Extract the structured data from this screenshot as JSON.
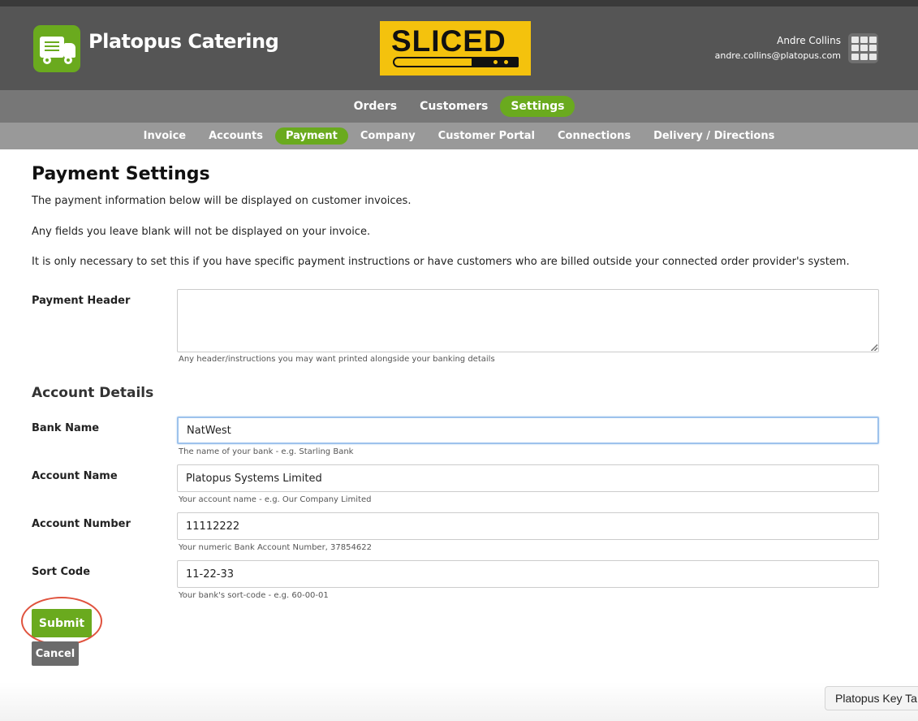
{
  "header": {
    "brand": "Platopus Catering",
    "partner_logo_text": "SLICED",
    "user_name": "Andre Collins",
    "user_email": "andre.collins@platopus.com"
  },
  "nav_primary": [
    {
      "label": "Orders",
      "active": false
    },
    {
      "label": "Customers",
      "active": false
    },
    {
      "label": "Settings",
      "active": true
    }
  ],
  "nav_secondary": [
    {
      "label": "Invoice",
      "active": false
    },
    {
      "label": "Accounts",
      "active": false
    },
    {
      "label": "Payment",
      "active": true
    },
    {
      "label": "Company",
      "active": false
    },
    {
      "label": "Customer Portal",
      "active": false
    },
    {
      "label": "Connections",
      "active": false
    },
    {
      "label": "Delivery / Directions",
      "active": false
    }
  ],
  "page": {
    "title": "Payment Settings",
    "intro": [
      "The payment information below will be displayed on customer invoices.",
      "Any fields you leave blank will not be displayed on your invoice.",
      "It is only necessary to set this if you have specific payment instructions or have customers who are billed outside your connected order provider's system."
    ]
  },
  "form": {
    "payment_header": {
      "label": "Payment Header",
      "value": "",
      "help": "Any header/instructions you may want printed alongside your banking details"
    },
    "section_title": "Account Details",
    "bank_name": {
      "label": "Bank Name",
      "value": "NatWest",
      "help": "The name of your bank - e.g. Starling Bank"
    },
    "account_name": {
      "label": "Account Name",
      "value": "Platopus Systems Limited",
      "help": "Your account name - e.g. Our Company Limited"
    },
    "account_number": {
      "label": "Account Number",
      "value": "11112222",
      "help": "Your numeric Bank Account Number, 37854622"
    },
    "sort_code": {
      "label": "Sort Code",
      "value": "11-22-33",
      "help": "Your bank's sort-code - e.g. 60-00-01"
    },
    "submit_label": "Submit",
    "cancel_label": "Cancel"
  },
  "key_tab_label": "Platopus Key Ta",
  "colors": {
    "accent": "#6aaa1e",
    "header_bg": "#555555",
    "highlight": "#e0533e"
  }
}
